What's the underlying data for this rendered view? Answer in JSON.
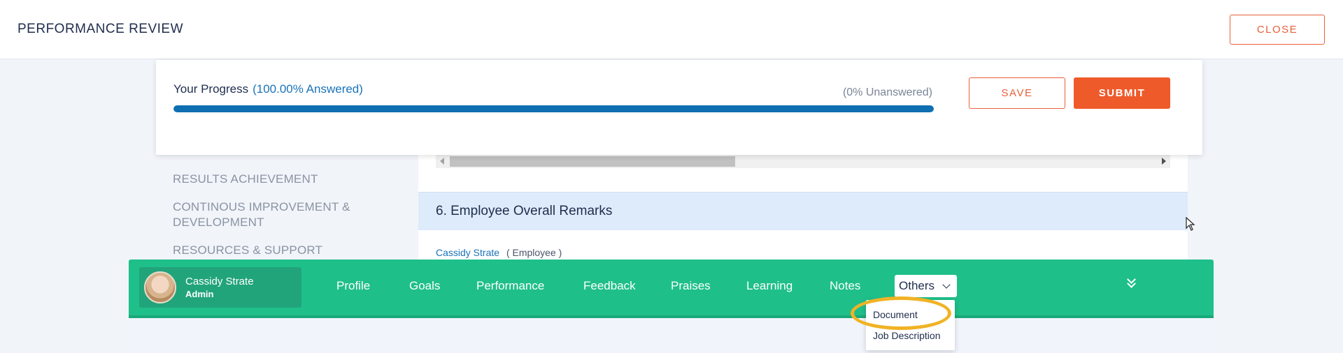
{
  "header": {
    "title": "PERFORMANCE REVIEW",
    "close_label": "CLOSE"
  },
  "progress": {
    "label": "Your Progress",
    "answered_text": "(100.00% Answered)",
    "unanswered_text": "(0% Unanswered)",
    "value_fraction": 1.0,
    "save_label": "SAVE",
    "submit_label": "SUBMIT"
  },
  "left_nav": {
    "items": [
      {
        "label": "RESULTS ACHIEVEMENT"
      },
      {
        "label": "CONTINOUS IMPROVEMENT & DEVELOPMENT"
      },
      {
        "label": "RESOURCES & SUPPORT"
      }
    ]
  },
  "content": {
    "section_title": "6. Employee Overall Remarks",
    "author_name": "Cassidy Strate",
    "author_role": "( Employee )"
  },
  "bottom_bar": {
    "user_name": "Cassidy Strate",
    "user_role": "Admin",
    "tabs": [
      {
        "label": "Profile"
      },
      {
        "label": "Goals"
      },
      {
        "label": "Performance"
      },
      {
        "label": "Feedback"
      },
      {
        "label": "Praises"
      },
      {
        "label": "Learning"
      },
      {
        "label": "Notes"
      }
    ],
    "others_label": "Others",
    "dropdown": [
      {
        "label": "Document"
      },
      {
        "label": "Job Description"
      }
    ]
  },
  "colors": {
    "accent_orange": "#ef5a2b",
    "progress_blue": "#0f6fb2",
    "bar_green": "#1fbf8a",
    "highlight_yellow": "#f0b325"
  }
}
